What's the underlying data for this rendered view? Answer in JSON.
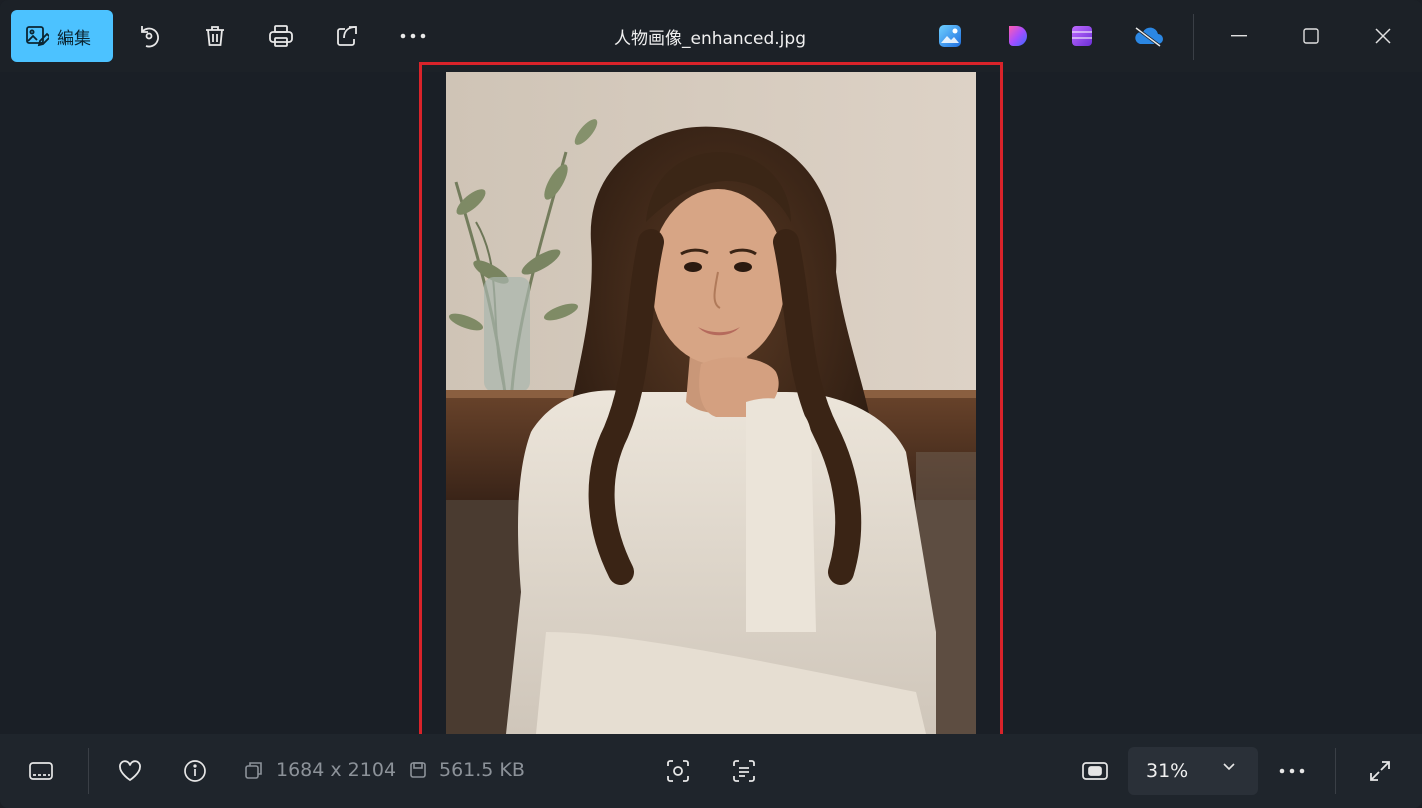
{
  "toolbar": {
    "edit_label": "編集",
    "title": "人物画像_enhanced.jpg",
    "icons": [
      "edit-image-icon",
      "rotate-icon",
      "delete-icon",
      "print-icon",
      "share-icon",
      "more-icon"
    ],
    "apps": [
      "photos-app-icon",
      "clipchamp-copilot-icon",
      "clipchamp-icon",
      "onedrive-icon"
    ],
    "window_controls": [
      "minimize-icon",
      "maximize-icon",
      "close-icon"
    ]
  },
  "image": {
    "description_alt": "人物画像_enhanced.jpg"
  },
  "bottom": {
    "dimensions": "1684 x 2104",
    "file_size": "561.5 KB",
    "zoom": "31%",
    "icons": [
      "filmstrip-icon",
      "favorite-heart-icon",
      "info-icon",
      "dimensions-icon",
      "save-disk-icon",
      "visual-search-icon",
      "text-scan-icon",
      "fit-to-window-icon",
      "more-icon",
      "fullscreen-icon"
    ]
  },
  "colors": {
    "accent": "#4cc2ff",
    "highlight": "#d9232a",
    "background": "#1c2127"
  }
}
